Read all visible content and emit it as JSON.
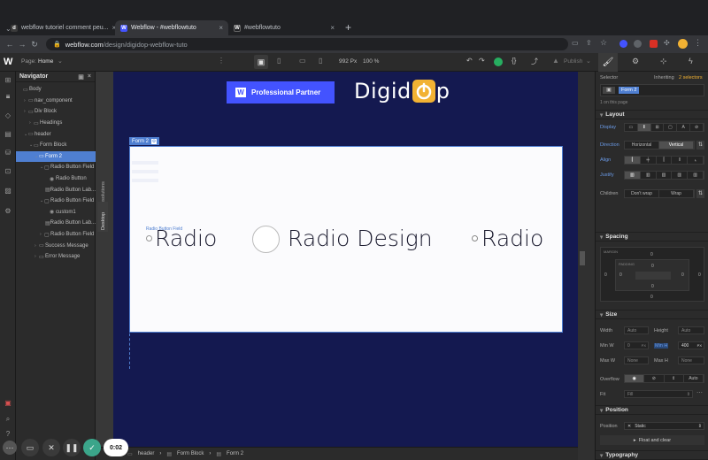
{
  "tabs": [
    {
      "label": "webflow tutoriel comment peu...",
      "favicon": "d",
      "favicon_color": "#3a3a3a"
    },
    {
      "label": "Webflow - #webflowtuto",
      "favicon": "W",
      "favicon_color": "#4353ff"
    },
    {
      "label": "#webflowtuto",
      "favicon": "W",
      "favicon_color": "#202124"
    }
  ],
  "address": {
    "host": "webflow.com",
    "path": "/design/digidop-webflow-tuto"
  },
  "topbar": {
    "logo": "W",
    "page_label": "Page:",
    "page_name": "Home",
    "canvas_width": "992",
    "canvas_unit": "Px",
    "zoom": "100 %",
    "publish_label": "Publish"
  },
  "navigator": {
    "title": "Navigator",
    "rows": [
      {
        "label": "Body",
        "depth": 0,
        "arrow": "",
        "icon": "▭"
      },
      {
        "label": "nav_component",
        "depth": 1,
        "arrow": "›",
        "icon": "▭"
      },
      {
        "label": "Div Block",
        "depth": 1,
        "arrow": "›",
        "icon": "▭"
      },
      {
        "label": "Headings",
        "depth": 2,
        "arrow": "›",
        "icon": "▭"
      },
      {
        "label": "header",
        "depth": 1,
        "arrow": "⌄",
        "icon": "▭"
      },
      {
        "label": "Form Block",
        "depth": 2,
        "arrow": "⌄",
        "icon": "▭"
      },
      {
        "label": "Form 2",
        "depth": 3,
        "arrow": "⌄",
        "icon": "▭",
        "selected": true
      },
      {
        "label": "Radio Button Field",
        "depth": 4,
        "arrow": "⌄",
        "icon": "▢"
      },
      {
        "label": "Radio Button",
        "depth": 5,
        "arrow": "",
        "icon": "◉"
      },
      {
        "label": "Radio Button Lab...",
        "depth": 5,
        "arrow": "",
        "icon": "▤"
      },
      {
        "label": "Radio Button Field",
        "depth": 4,
        "arrow": "⌄",
        "icon": "▢"
      },
      {
        "label": "custom1",
        "depth": 5,
        "arrow": "",
        "icon": "◉"
      },
      {
        "label": "Radio Button Lab...",
        "depth": 5,
        "arrow": "",
        "icon": "▤"
      },
      {
        "label": "Radio Button Field",
        "depth": 4,
        "arrow": "›",
        "icon": "▢"
      },
      {
        "label": "Success Message",
        "depth": 3,
        "arrow": "›",
        "icon": "▭"
      },
      {
        "label": "Error Message",
        "depth": 3,
        "arrow": "›",
        "icon": "▭"
      }
    ]
  },
  "canvas": {
    "badge": "Professional Partner",
    "badge_logo": "W",
    "brand_left": "Digid",
    "brand_right": "p",
    "form_tag": "Form 2",
    "field_tag": "Radio Button Field",
    "radio1": "Radio",
    "radio2": "Radio Design",
    "radio3": "Radio",
    "side_label_1": "Affects all resolutions",
    "side_label_2": "Desktop"
  },
  "right_panel": {
    "tab_icons": [
      "brush-icon",
      "gear-icon",
      "interactions-icon",
      "lightning-icon"
    ],
    "selector_label": "Selector",
    "inheriting": "Inheriting",
    "selectors_count": "2 selectors",
    "selector_chip": "Form 2",
    "on_page": "1 on this page",
    "layout": {
      "title": "Layout",
      "display": "Display",
      "direction": "Direction",
      "horizontal": "Horizontal",
      "vertical": "Vertical",
      "align": "Align",
      "justify": "Justify",
      "children": "Children",
      "dont_wrap": "Don't wrap",
      "wrap": "Wrap"
    },
    "spacing": {
      "title": "Spacing",
      "margin": "MARGIN",
      "padding": "PADDING",
      "zero": "0"
    },
    "size": {
      "title": "Size",
      "width": "Width",
      "width_val": "Auto",
      "height": "Height",
      "height_val": "Auto",
      "min_w": "Min W",
      "min_w_val": "0",
      "min_w_unit": "PX",
      "min_h": "Min H",
      "min_h_val": "400",
      "min_h_unit": "PX",
      "max_w": "Max W",
      "max_w_val": "None",
      "max_h": "Max H",
      "max_h_val": "None",
      "overflow": "Overflow",
      "overflow_auto": "Auto",
      "fit": "Fit",
      "fit_val": "Fill"
    },
    "position": {
      "title": "Position",
      "label": "Position",
      "value": "Static",
      "float": "Float and clear"
    },
    "typography": {
      "title": "Typography"
    }
  },
  "breadcrumb": [
    "header",
    "Form Block",
    "Form 2"
  ],
  "recorder": {
    "time": "0:02"
  }
}
